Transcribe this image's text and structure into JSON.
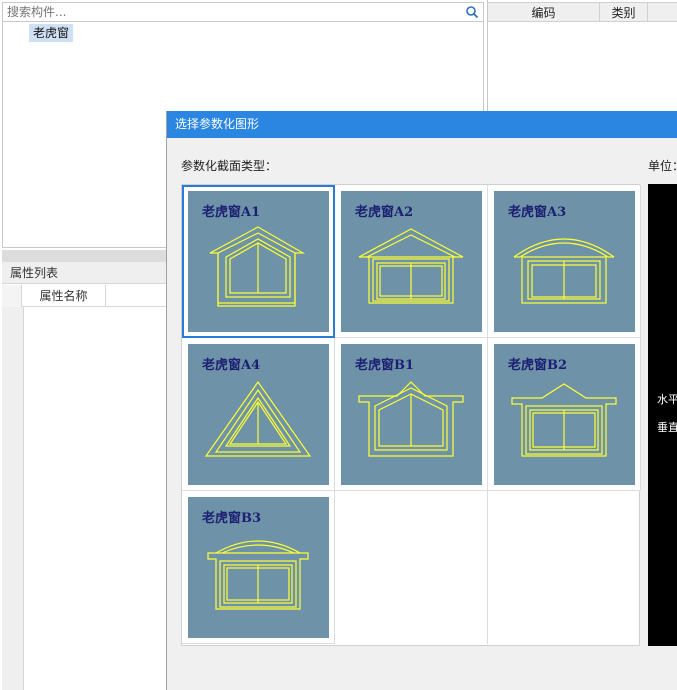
{
  "search": {
    "placeholder": "搜索构件..."
  },
  "tree": {
    "selected_item": "老虎窗"
  },
  "properties": {
    "header": "属性列表",
    "col_name": "属性名称"
  },
  "right_table": {
    "col_code": "编码",
    "col_category": "类别"
  },
  "dialog": {
    "title": "选择参数化图形",
    "section_label": "参数化截面类型：",
    "unit_label": "单位：",
    "preview_labels": [
      "水平",
      "垂直"
    ],
    "shapes": [
      {
        "label": "老虎窗A1",
        "icon": "dormer-a1-icon",
        "selected": true
      },
      {
        "label": "老虎窗A2",
        "icon": "dormer-a2-icon",
        "selected": false
      },
      {
        "label": "老虎窗A3",
        "icon": "dormer-a3-icon",
        "selected": false
      },
      {
        "label": "老虎窗A4",
        "icon": "dormer-a4-icon",
        "selected": false
      },
      {
        "label": "老虎窗B1",
        "icon": "dormer-b1-icon",
        "selected": false
      },
      {
        "label": "老虎窗B2",
        "icon": "dormer-b2-icon",
        "selected": false
      },
      {
        "label": "老虎窗B3",
        "icon": "dormer-b3-icon",
        "selected": false
      }
    ]
  },
  "colors": {
    "titlebar": "#2a86e0",
    "thumb_bg": "#6e93a9",
    "drawing": "#ffff33",
    "label": "#1c1f72"
  }
}
